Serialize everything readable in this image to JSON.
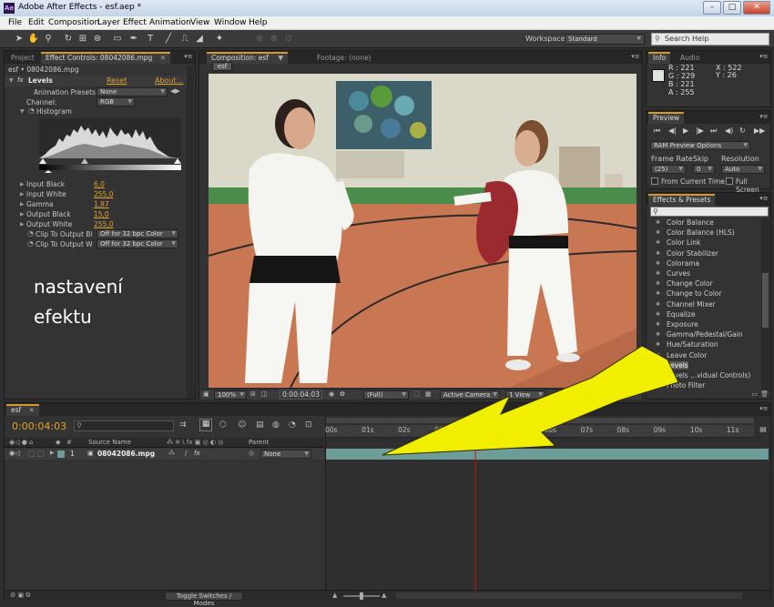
{
  "window": {
    "title": "Adobe After Effects - esf.aep *",
    "icon": "after-effects-logo"
  },
  "menu": [
    "File",
    "Edit",
    "Composition",
    "Layer",
    "Effect",
    "Animation",
    "View",
    "Window",
    "Help"
  ],
  "toolbar": {
    "workspace_label": "Workspace:",
    "workspace_value": "Standard",
    "search_placeholder": "Search Help"
  },
  "left_panel": {
    "tabs": [
      "Project",
      "Effect Controls: 08042086.mpg"
    ],
    "subtitle": "esf • 08042086.mpg",
    "effect_name": "Levels",
    "reset": "Reset",
    "about": "About...",
    "animation_presets_label": "Animation Presets:",
    "animation_presets_value": "None",
    "channel_label": "Channel:",
    "channel_value": "RGB",
    "histogram_label": "Histogram",
    "properties": [
      {
        "name": "Input Black",
        "value": "6,0"
      },
      {
        "name": "Input White",
        "value": "255,0"
      },
      {
        "name": "Gamma",
        "value": "1,87"
      },
      {
        "name": "Output Black",
        "value": "15,0"
      },
      {
        "name": "Output White",
        "value": "255,0"
      }
    ],
    "clip_black_label": "Clip To Output Bl",
    "clip_black_value": "Off for 32 bpc Color",
    "clip_white_label": "Clip To Output W",
    "clip_white_value": "Off for 32 bpc Color",
    "annotation_line1": "nastavení",
    "annotation_line2": "efektu"
  },
  "composition": {
    "tab": "Composition: esf",
    "footage_tab": "Footage: (none)",
    "comp_label": "esf",
    "zoom": "100%",
    "timecode": "0:00:04:03",
    "resolution": "(Full)",
    "camera": "Active Camera",
    "views": "1 View"
  },
  "info": {
    "tabs": [
      "Info",
      "Audio"
    ],
    "r": "R : 221",
    "g": "G : 229",
    "b": "B : 221",
    "a": "A : 255",
    "x": "X : 522",
    "y": "Y : 26",
    "swatch_color": "#dde5dd"
  },
  "preview": {
    "tab": "Preview",
    "ram_options": "RAM Preview Options",
    "frame_rate_label": "Frame Rate",
    "frame_rate": "(25)",
    "skip_label": "Skip",
    "skip": "0",
    "resolution_label": "Resolution",
    "resolution": "Auto",
    "from_current": "From Current Time",
    "full_screen": "Full Screen"
  },
  "effects_presets": {
    "tab": "Effects & Presets",
    "items": [
      "Color Balance",
      "Color Balance (HLS)",
      "Color Link",
      "Color Stabilizer",
      "Colorama",
      "Curves",
      "Change Color",
      "Change to Color",
      "Channel Mixer",
      "Equalize",
      "Exposure",
      "Gamma/Pedestal/Gain",
      "Hue/Saturation",
      "Leave Color",
      "Levels",
      "Levels ...vidual Controls)",
      "Photo Filter"
    ],
    "selected": "Levels"
  },
  "timeline": {
    "tab": "esf",
    "timecode": "0:00:04:03",
    "col_source": "Source Name",
    "col_parent": "Parent",
    "layer_number": "1",
    "layer_name": "08042086.mpg",
    "parent_value": "None",
    "toggle": "Toggle Switches / Modes",
    "ruler": [
      "00s",
      "01s",
      "02s",
      "03s",
      "04s",
      "05s",
      "06s",
      "07s",
      "08s",
      "09s",
      "10s",
      "11s"
    ],
    "playhead_seconds": 4.12,
    "duration_seconds": 12
  },
  "colors": {
    "accent": "#e0a32a",
    "arrow": "#f5f000",
    "playhead": "#d01010",
    "layer_bar": "#6e9c98"
  }
}
